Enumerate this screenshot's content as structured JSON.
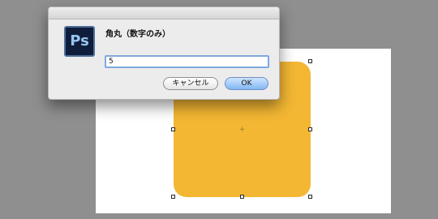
{
  "dialog": {
    "prompt": "角丸（数字のみ）",
    "input_value": "5",
    "cancel_label": "キャンセル",
    "ok_label": "OK",
    "app_icon_text": "Ps"
  },
  "canvas": {
    "shape_color": "#f3b733",
    "artboard_color": "#ffffff",
    "center_mark": "+"
  },
  "colors": {
    "background": "#8f8f8f",
    "dialog": "#ececec",
    "accent": "#81b7f3"
  }
}
